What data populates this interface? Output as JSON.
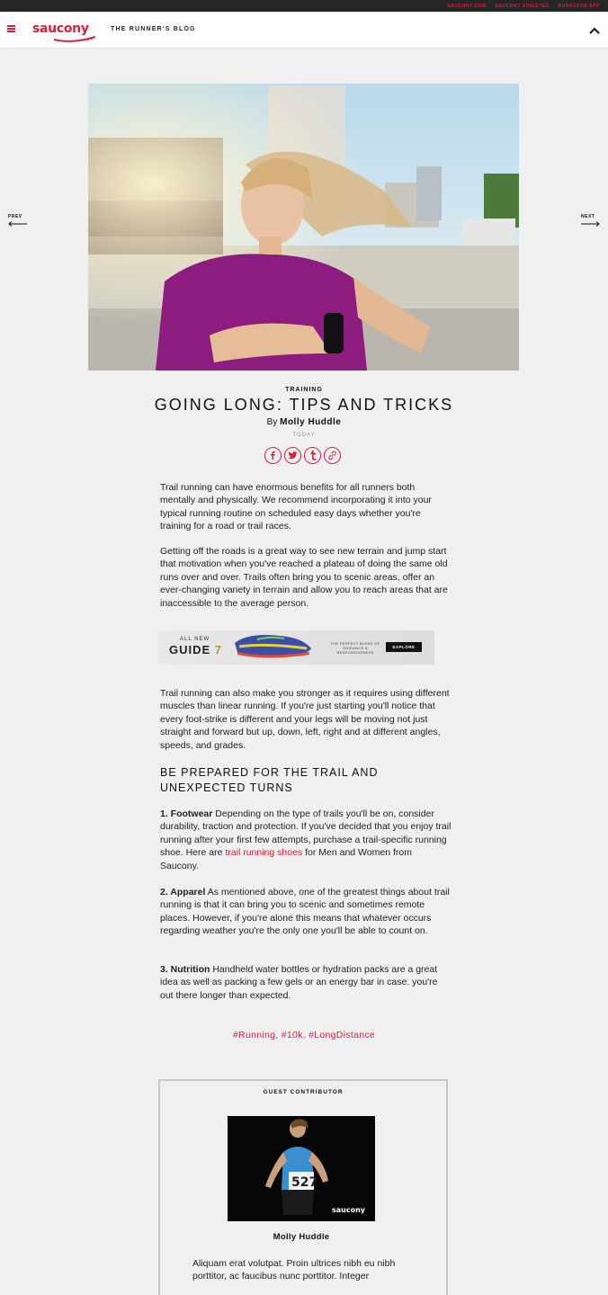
{
  "topbar": {
    "links": [
      "SAUCONY.COM",
      "SAUCONY ATHLETES",
      "RUN4GOOD APP"
    ]
  },
  "header": {
    "logo": "saucony",
    "blog_title": "THE RUNNER'S BLOG"
  },
  "nav": {
    "prev": "PREV",
    "next": "NEXT"
  },
  "article": {
    "category": "TRAINING",
    "title": "GOING LONG: TIPS AND TRICKS",
    "by": "By",
    "author": "Molly Huddle",
    "date": "TODAY",
    "share": [
      "facebook-icon",
      "twitter-icon",
      "tumblr-icon",
      "link-icon"
    ],
    "p1": "Trail running can have enormous benefits for all runners both mentally and physically. We recommend incorporating it into your typical running routine on scheduled easy days whether you're training for a road or trail races.",
    "p2": "Getting off the roads is a great way to see new terrain and jump start that motivation when you've reached a plateau of doing the same old runs over and over. Trails often bring you to scenic areas, offer an ever-changing variety in terrain and allow you to reach areas that are inaccessible to the average person.",
    "p3": "Trail running can also make you stronger as it requires using different muscles than linear running. If you're just starting you'll notice that every foot-strike is different and your legs will be moving not just straight and forward but up, down, left, right and at different angles, speeds, and grades.",
    "heading": "BE PREPARED FOR THE TRAIL AND UNEXPECTED TURNS",
    "tip1_title": "1. Footwear",
    "tip1_text_a": " Depending on the type of trails you'll be on, consider durability, traction and protection. If you've decided that you enjoy trail running after your first few attempts, purchase a trail-specific running shoe. Here are ",
    "tip1_link": "trail running shoes",
    "tip1_text_b": " for Men and Women from Saucony.",
    "tip2_title": "2. Apparel",
    "tip2_text": " As mentioned above, one of the greatest things about trail running is that it can bring you to scenic and sometimes remote places. However, if you're alone this means that whatever occurs regarding weather you're the only one you'll be able to count on.",
    "tip3_title": "3. Nutrition",
    "tip3_text": " Handheld water bottles or hydration packs are a great idea as well as packing a few gels or an energy bar in case. you're out there longer than expected.",
    "tags": "#Running, #10k, #LongDistance"
  },
  "ad": {
    "all_new": "ALL NEW",
    "guide": "GUIDE",
    "number": "7",
    "tagline": "THE PERFECT BLEND OF GUIDANCE & RESPONSIVENESS",
    "button": "EXPLORE"
  },
  "contributor": {
    "label": "GUEST CONTRIBUTOR",
    "name": "Molly Huddle",
    "bib": "527",
    "bio": "Aliquam erat volutpat. Proin ultrices nibh eu nibh porttitor, ac faucibus nunc porttitor. Integer"
  },
  "colors": {
    "brand": "#d8203a",
    "background": "#f0f0f0",
    "topbar": "#262626"
  }
}
